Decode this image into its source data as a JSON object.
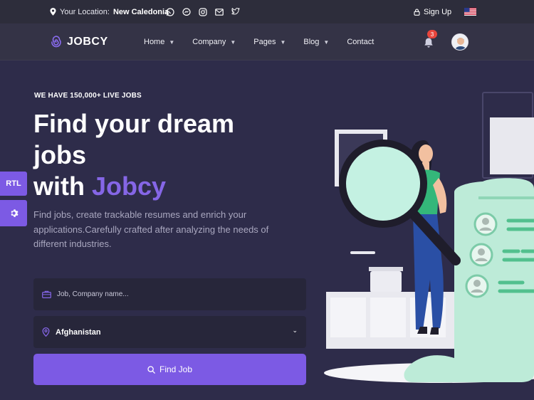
{
  "topbar": {
    "location_label": "Your Location:",
    "location_value": "New Caledonia",
    "signup": "Sign Up"
  },
  "nav": {
    "brand": "JOBCY",
    "items": [
      {
        "label": "Home",
        "dropdown": true
      },
      {
        "label": "Company",
        "dropdown": true
      },
      {
        "label": "Pages",
        "dropdown": true
      },
      {
        "label": "Blog",
        "dropdown": true
      },
      {
        "label": "Contact",
        "dropdown": false
      }
    ],
    "notifications": "3"
  },
  "hero": {
    "eyebrow": "WE HAVE 150,000+ LIVE JOBS",
    "title_line1": "Find your dream",
    "title_line2": "jobs",
    "title_line3_pre": "with ",
    "title_highlight": "Jobcy",
    "description": "Find jobs, create trackable resumes and enrich your applications.Carefully crafted after analyzing the needs of different industries."
  },
  "side": {
    "rtl": "RTL"
  },
  "search": {
    "job_placeholder": "Job, Company name...",
    "location_value": "Afghanistan",
    "button": "Find Job"
  },
  "colors": {
    "accent": "#7c5ae4",
    "highlight": "#8566e6",
    "hero_bg": "#2e2c4a",
    "mint": "#bdebd8"
  },
  "icons": {
    "location": "map-pin-icon",
    "whatsapp": "whatsapp-icon",
    "messenger": "messenger-icon",
    "instagram": "instagram-icon",
    "mail": "mail-icon",
    "twitter": "twitter-icon",
    "lock": "lock-icon",
    "bell": "bell-icon",
    "gear": "gear-icon",
    "briefcase": "briefcase-icon",
    "search": "search-icon"
  }
}
